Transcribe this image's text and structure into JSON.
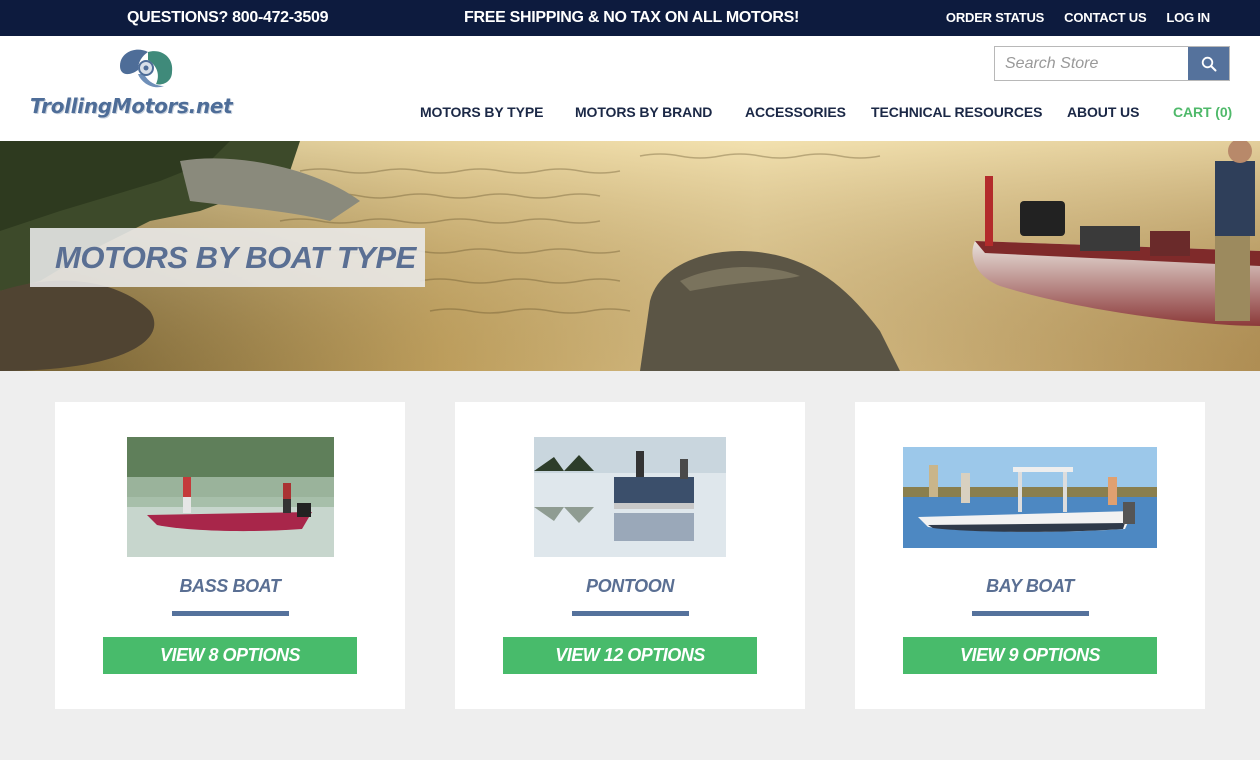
{
  "topbar": {
    "phone": "QUESTIONS? 800-472-3509",
    "promo": "FREE SHIPPING & NO TAX ON ALL MOTORS!",
    "links": [
      "ORDER STATUS",
      "CONTACT US",
      "LOG IN"
    ]
  },
  "header": {
    "logo_text": "TrollingMotors.net",
    "search": {
      "placeholder": "Search Store"
    },
    "nav": [
      "MOTORS BY TYPE",
      "MOTORS BY BRAND",
      "ACCESSORIES",
      "TECHNICAL RESOURCES",
      "ABOUT US",
      "CART (0)"
    ]
  },
  "hero": {
    "title": "MOTORS BY BOAT TYPE"
  },
  "cards": [
    {
      "title": "BASS BOAT",
      "button": "VIEW 8 OPTIONS"
    },
    {
      "title": "PONTOON",
      "button": "VIEW 12 OPTIONS"
    },
    {
      "title": "BAY BOAT",
      "button": "VIEW 9 OPTIONS"
    }
  ],
  "colors": {
    "topbar_bg": "#0d1b3e",
    "nav_text": "#1b2846",
    "cart_green": "#4fb96a",
    "accent_blue": "#55729c",
    "button_green": "#48bb6b",
    "page_bg": "#eeeeee"
  },
  "icons": {
    "search_button": "search-icon",
    "logo_mark": "propeller-icon"
  }
}
